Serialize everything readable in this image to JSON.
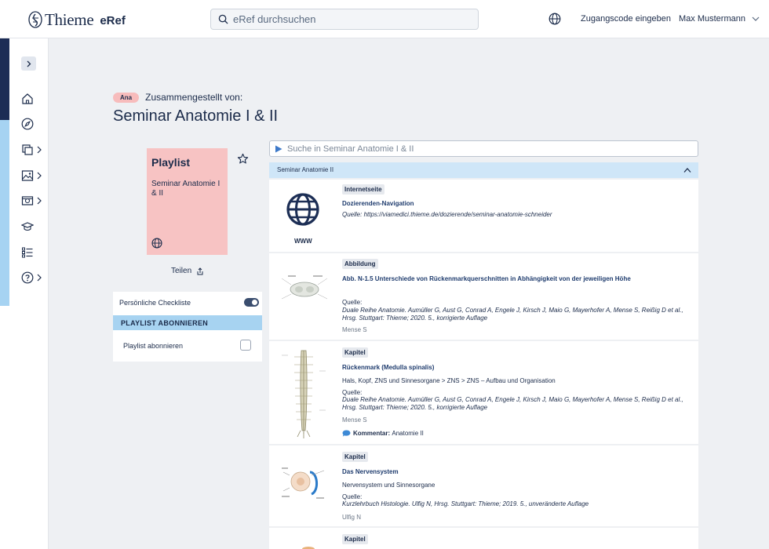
{
  "header": {
    "logo_text": "Thieme",
    "product": "eRef",
    "search_placeholder": "eRef durchsuchen",
    "access_code": "Zugangscode eingeben",
    "user_name": "Max Mustermann"
  },
  "nav": {
    "icons": [
      "home-icon",
      "compass-icon",
      "copy-icon",
      "image-icon",
      "video-icon",
      "graduation-cap-icon",
      "list-icon",
      "help-icon"
    ]
  },
  "page": {
    "tag": "Ana",
    "compiled_by": "Zusammengestellt von:",
    "title": "Seminar Anatomie I & II"
  },
  "playlist_card": {
    "title": "Playlist",
    "subtitle": "Seminar Anatomie I & II",
    "share_label": "Teilen"
  },
  "side_panel": {
    "checklist_label": "Persönliche Checkliste",
    "subscribe_header": "PLAYLIST ABONNIEREN",
    "subscribe_label": "Playlist abonnieren"
  },
  "content": {
    "search_placeholder": "Suche in Seminar Anatomie I & II",
    "section_title": "Seminar Anatomie II",
    "items": [
      {
        "type": "Internetseite",
        "title": "Dozierenden-Navigation",
        "source": "Quelle: https://viamedici.thieme.de/dozierende/seminar-anatomie-schneider",
        "thumb_label": "WWW"
      },
      {
        "type": "Abbildung",
        "title": "Abb. N-1.5 Unterschiede von Rückenmarkquerschnitten in Abhängigkeit von der jeweiligen Höhe",
        "source_label": "Quelle:",
        "source": "Duale Reihe Anatomie. Aumüller G, Aust G, Conrad A, Engele J, Kirsch J, Maio G, Mayerhofer A, Mense S, Reißig D et al., Hrsg. Stuttgart: Thieme; 2020. 5., korrigierte Auflage",
        "author": "Mense S"
      },
      {
        "type": "Kapitel",
        "title": "Rückenmark (Medulla spinalis)",
        "path": "Hals, Kopf, ZNS und Sinnesorgane > ZNS > ZNS – Aufbau und Organisation",
        "source_label": "Quelle:",
        "source": "Duale Reihe Anatomie. Aumüller G, Aust G, Conrad A, Engele J, Kirsch J, Maio G, Mayerhofer A, Mense S, Reißig D et al., Hrsg. Stuttgart: Thieme; 2020. 5., korrigierte Auflage",
        "author": "Mense S",
        "comment_label": "Kommentar:",
        "comment_text": "Anatomie II"
      },
      {
        "type": "Kapitel",
        "title": "Das Nervensystem",
        "path": "Nervensystem und Sinnesorgane",
        "source_label": "Quelle:",
        "source": "Kurzlehrbuch Histologie. Ulfig N, Hrsg. Stuttgart: Thieme; 2019. 5., unveränderte Auflage",
        "author": "Ulfig N"
      },
      {
        "type": "Kapitel"
      }
    ]
  },
  "colors": {
    "navy": "#1b2b4a",
    "link": "#1f3c6e",
    "accent_light_blue": "#a6d3f2",
    "playlist_pink": "#f7c3c3",
    "tag_pink": "#f7bcbc"
  }
}
